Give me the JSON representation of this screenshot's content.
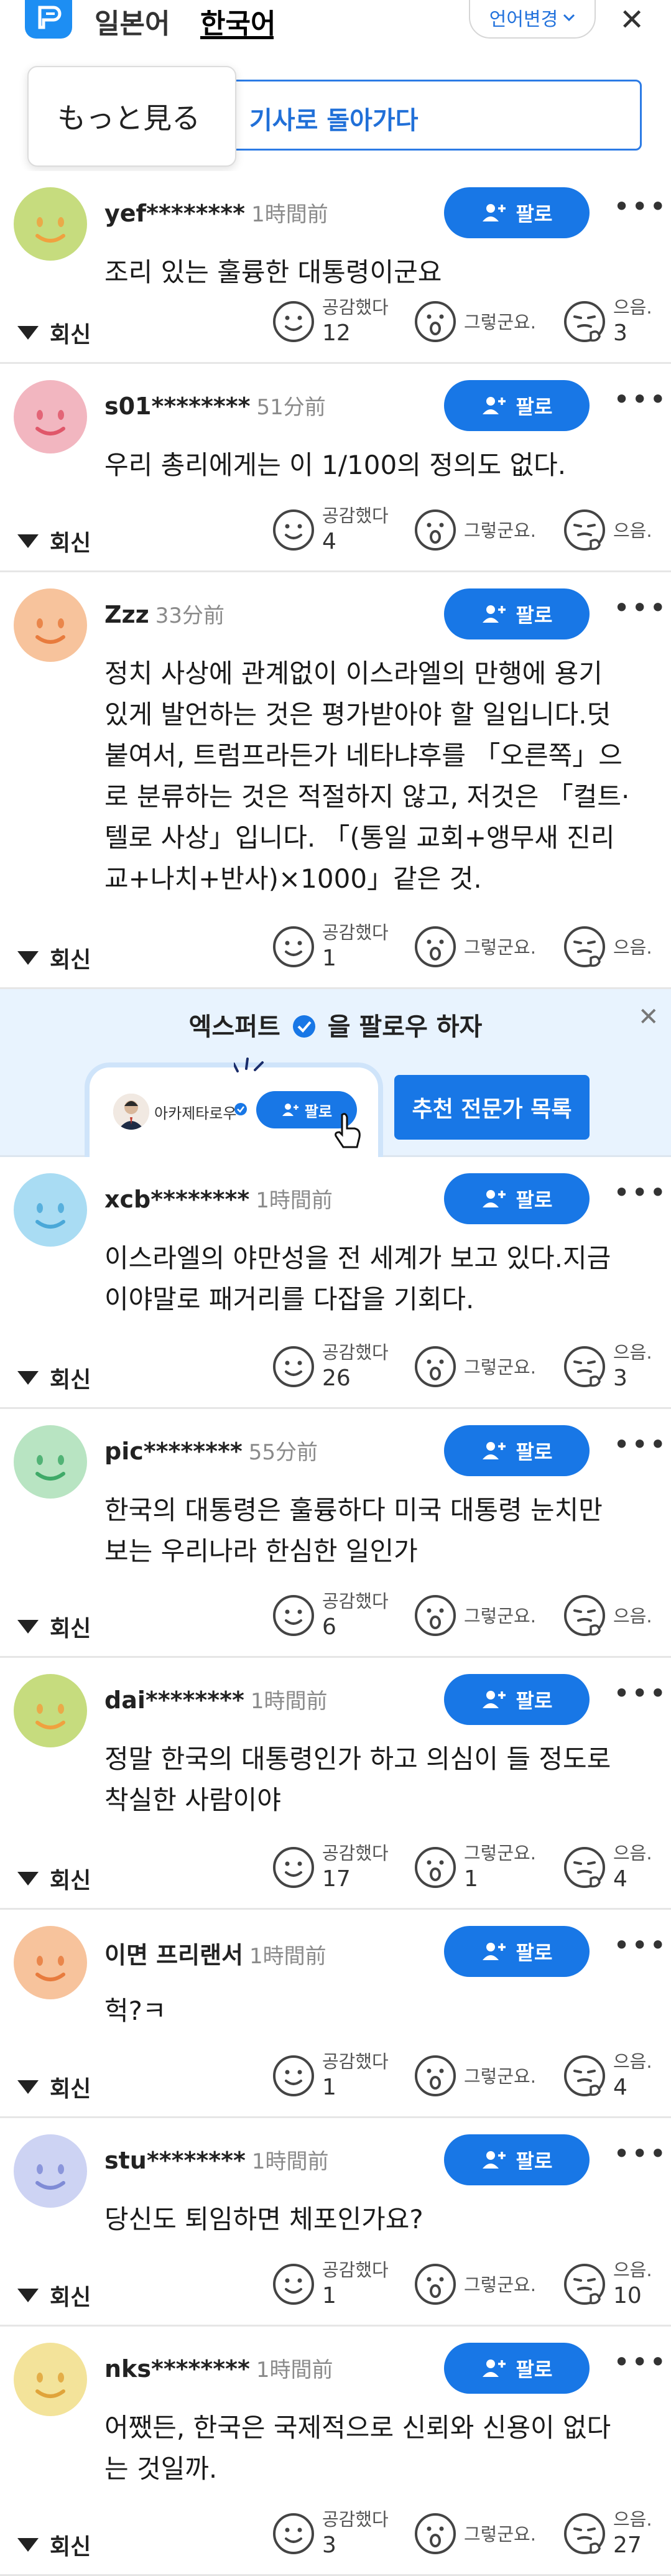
{
  "header": {
    "lang_ja": "일본어",
    "lang_ko": "한국어",
    "lang_change": "언어변경",
    "back_to_article": "기사로 돌아가다",
    "more_popup": "もっと見る"
  },
  "common": {
    "follow": "팔로",
    "reply": "회신",
    "react_empathy": "공감했다",
    "react_surprise": "그렇군요.",
    "react_think": "으음."
  },
  "colors": {
    "accent": "#1877e6",
    "back_border": "#2c7be5",
    "expert_bg": "#e8f3fe"
  },
  "comments": [
    {
      "user": "yef********",
      "time": "1時間前",
      "text": [
        "조리 있는 훌륭한 대통령이군요"
      ],
      "empathy": "12",
      "surprise": "",
      "think": "3",
      "avatar_color": "#c6dc7e",
      "mouth_color": "#f0a13f"
    },
    {
      "user": "s01********",
      "time": "51分前",
      "text": [
        "우리 총리에게는 이 1/100의 정의도 없다."
      ],
      "empathy": "4",
      "surprise": "",
      "think": "",
      "avatar_color": "#f2b6c0",
      "mouth_color": "#e0576a"
    },
    {
      "user": "Zzz",
      "time": "33分前",
      "text": [
        "정치 사상에 관계없이 이스라엘의 만행에 용기",
        "있게 발언하는 것은 평가받아야 할 일입니다.덧",
        "붙여서, 트럼프라든가 네타냐후를 「오른쪽」으",
        "로 분류하는 것은 적절하지 않고, 저것은 「컬트·",
        "텔로 사상」입니다. 「(통일 교회+앵무새 진리",
        "교+나치+반사)×1000」같은 것."
      ],
      "empathy": "1",
      "surprise": "",
      "think": "",
      "avatar_color": "#f7c39c",
      "mouth_color": "#e87b3d"
    },
    {
      "user": "xcb********",
      "time": "1時間前",
      "text": [
        "이스라엘의 야만성을 전 세계가 보고 있다.지금",
        "이야말로 패거리를 다잡을 기회다."
      ],
      "empathy": "26",
      "surprise": "",
      "think": "3",
      "avatar_color": "#a9dcf3",
      "mouth_color": "#4aa8d8"
    },
    {
      "user": "pic********",
      "time": "55分前",
      "text": [
        "한국의 대통령은 훌륭하다 미국 대통령 눈치만",
        "보는 우리나라 한심한 일인가"
      ],
      "empathy": "6",
      "surprise": "",
      "think": "",
      "avatar_color": "#b8e4c2",
      "mouth_color": "#3faa68"
    },
    {
      "user": "dai********",
      "time": "1時間前",
      "text": [
        "정말 한국의 대통령인가 하고 의심이 들 정도로",
        "착실한 사람이야"
      ],
      "empathy": "17",
      "surprise": "1",
      "think": "4",
      "avatar_color": "#c6dc7e",
      "mouth_color": "#f0a13f"
    },
    {
      "user": "이면 프리랜서",
      "time": "1時間前",
      "text": [
        "헉?ㅋ"
      ],
      "empathy": "1",
      "surprise": "",
      "think": "4",
      "avatar_color": "#f7c39c",
      "mouth_color": "#e87b3d"
    },
    {
      "user": "stu********",
      "time": "1時間前",
      "text": [
        "당신도 퇴임하면 체포인가요?"
      ],
      "empathy": "1",
      "surprise": "",
      "think": "10",
      "avatar_color": "#cdd3f3",
      "mouth_color": "#7f8bd6"
    },
    {
      "user": "nks********",
      "time": "1時間前",
      "text": [
        "어쨌든, 한국은 국제적으로 신뢰와 신용이 없다",
        "는 것일까."
      ],
      "empathy": "3",
      "surprise": "",
      "think": "27",
      "avatar_color": "#f3e39a",
      "mouth_color": "#e0a43a"
    }
  ],
  "expert_banner": {
    "title_left": "엑스퍼트",
    "title_right": "을 팔로우 하자",
    "sample_name": "아카제타로우",
    "sample_follow": "팔로",
    "recommend": "추천 전문가 목록"
  }
}
